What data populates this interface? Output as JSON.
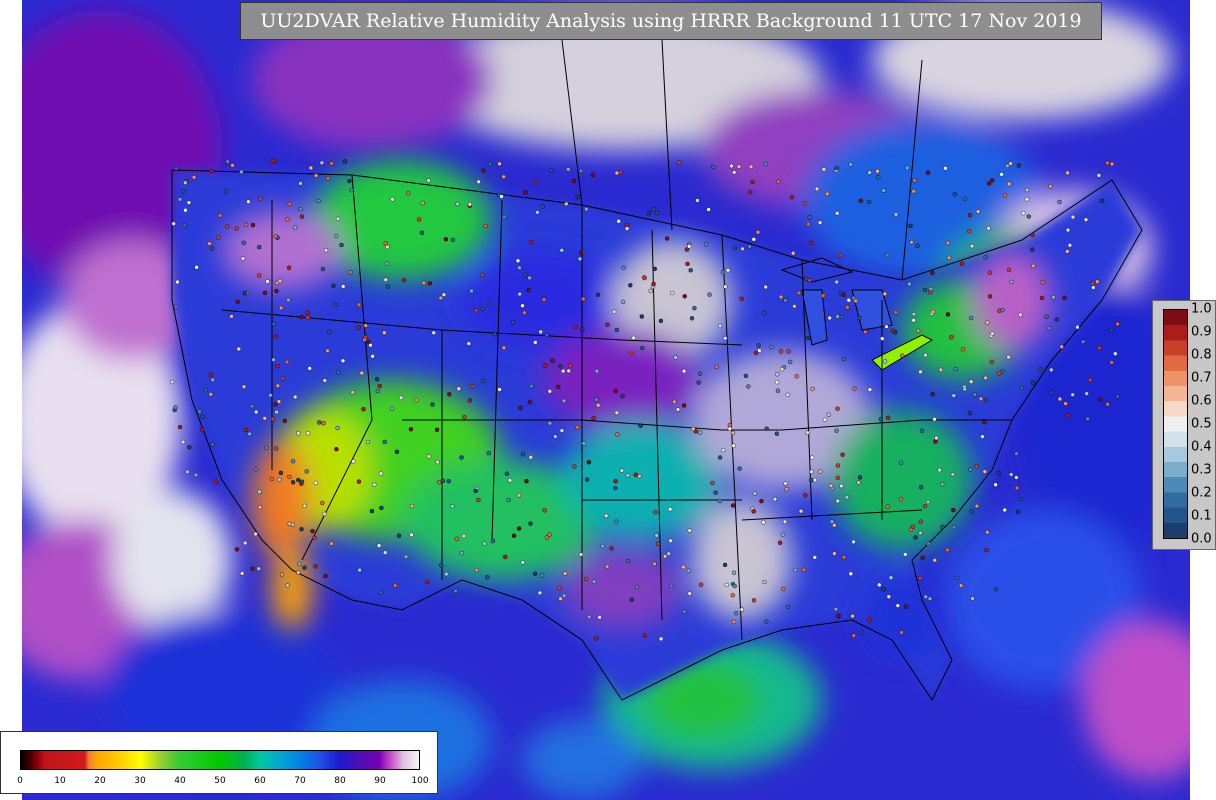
{
  "title": "UU2DVAR Relative Humidity Analysis using HRRR Background 11 UTC 17 Nov 2019",
  "rh_colorbar": {
    "ticks": [
      "0",
      "10",
      "20",
      "30",
      "40",
      "50",
      "60",
      "70",
      "80",
      "90",
      "100"
    ],
    "min": 0,
    "max": 100,
    "stops": [
      {
        "v": 0,
        "c": "#000000"
      },
      {
        "v": 2,
        "c": "#3a0000"
      },
      {
        "v": 4,
        "c": "#8b0000"
      },
      {
        "v": 6,
        "c": "#c0141c"
      },
      {
        "v": 16,
        "c": "#d21a1a"
      },
      {
        "v": 17,
        "c": "#f07a3a"
      },
      {
        "v": 19,
        "c": "#ffa500"
      },
      {
        "v": 26,
        "c": "#ffd700"
      },
      {
        "v": 30,
        "c": "#ffff00"
      },
      {
        "v": 35,
        "c": "#9acd32"
      },
      {
        "v": 40,
        "c": "#32cd32"
      },
      {
        "v": 50,
        "c": "#00c800"
      },
      {
        "v": 56,
        "c": "#00b050"
      },
      {
        "v": 60,
        "c": "#00c8a0"
      },
      {
        "v": 65,
        "c": "#00a8d0"
      },
      {
        "v": 70,
        "c": "#0082e6"
      },
      {
        "v": 75,
        "c": "#1e50e6"
      },
      {
        "v": 80,
        "c": "#1c1cd0"
      },
      {
        "v": 85,
        "c": "#4b0fb4"
      },
      {
        "v": 90,
        "c": "#7a00b4"
      },
      {
        "v": 93,
        "c": "#c850c8"
      },
      {
        "v": 96,
        "c": "#e0c0e0"
      },
      {
        "v": 100,
        "c": "#f4f4f4"
      }
    ]
  },
  "obs_colorbar": {
    "ticks": [
      "1.0",
      "0.9",
      "0.8",
      "0.7",
      "0.6",
      "0.5",
      "0.4",
      "0.3",
      "0.2",
      "0.1",
      "0.0"
    ],
    "min": 0.0,
    "max": 1.0,
    "bins": [
      "#1a3f6b",
      "#22558a",
      "#2f6c9f",
      "#4d8ab6",
      "#7aaecb",
      "#a6c9dd",
      "#d2e2ec",
      "#f0f0f0",
      "#f5d8c8",
      "#f4b594",
      "#ef9466",
      "#e06a42",
      "#c9402a",
      "#ab1d1d",
      "#7d0d14"
    ]
  },
  "colors": {
    "land_background": "#c8c8c8",
    "ocean_background": "#3838d8",
    "boundary_line": "#000000"
  }
}
